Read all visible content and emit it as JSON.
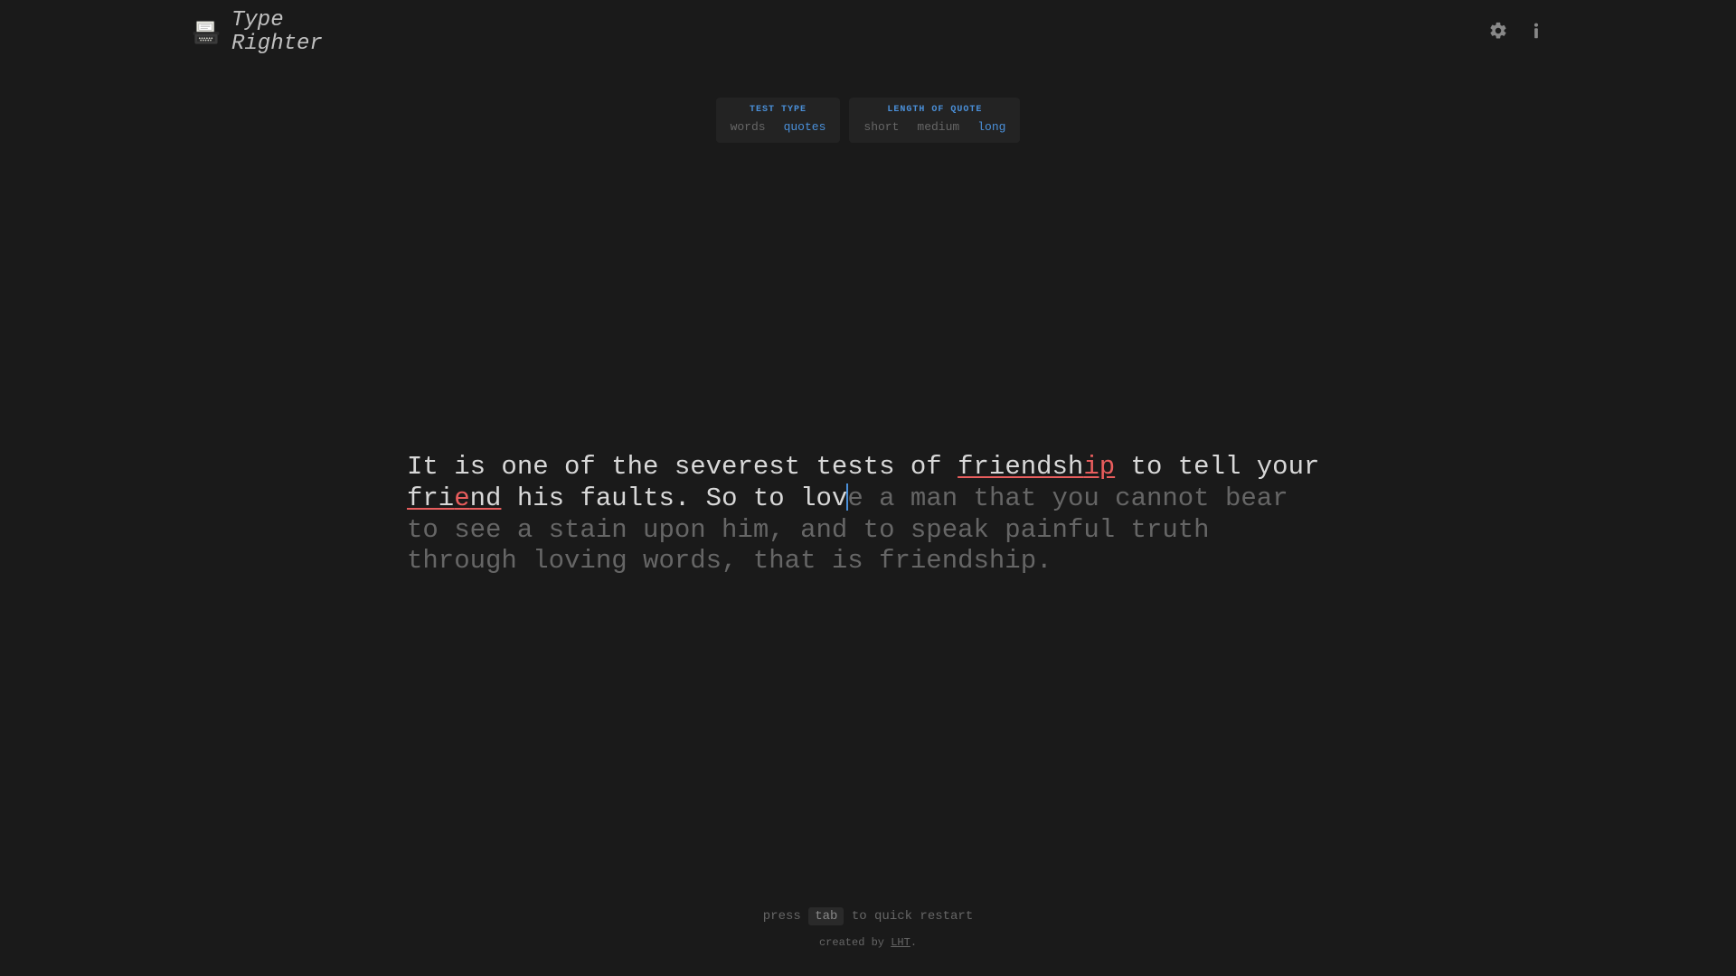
{
  "header": {
    "logo_line1": "Type",
    "logo_line2": "Righter"
  },
  "controls": {
    "test_type": {
      "label": "TEST TYPE",
      "options": [
        "words",
        "quotes"
      ],
      "active": "quotes"
    },
    "quote_length": {
      "label": "LENGTH OF QUOTE",
      "options": [
        "short",
        "medium",
        "long"
      ],
      "active": "long"
    }
  },
  "quote": {
    "segments": [
      {
        "text": "It is one of the severest tests of ",
        "state": "correct"
      },
      {
        "text": "friendsh",
        "state": "word-error-correct"
      },
      {
        "text": "ip",
        "state": "error"
      },
      {
        "text": " to tell your ",
        "state": "correct"
      },
      {
        "text": "fri",
        "state": "word-error-correct"
      },
      {
        "text": "e",
        "state": "error"
      },
      {
        "text": "nd",
        "state": "word-error-correct"
      },
      {
        "text": " his faults. So to lov",
        "state": "correct"
      },
      {
        "text": "e a man that you cannot bear to see a stain upon him, and to speak painful truth through loving words, that is friendship.",
        "state": "untyped"
      }
    ]
  },
  "footer": {
    "restart_pre": "press",
    "restart_key": "tab",
    "restart_post": "to quick restart",
    "credit_pre": "created by ",
    "credit_link": "LHT",
    "credit_post": "."
  }
}
